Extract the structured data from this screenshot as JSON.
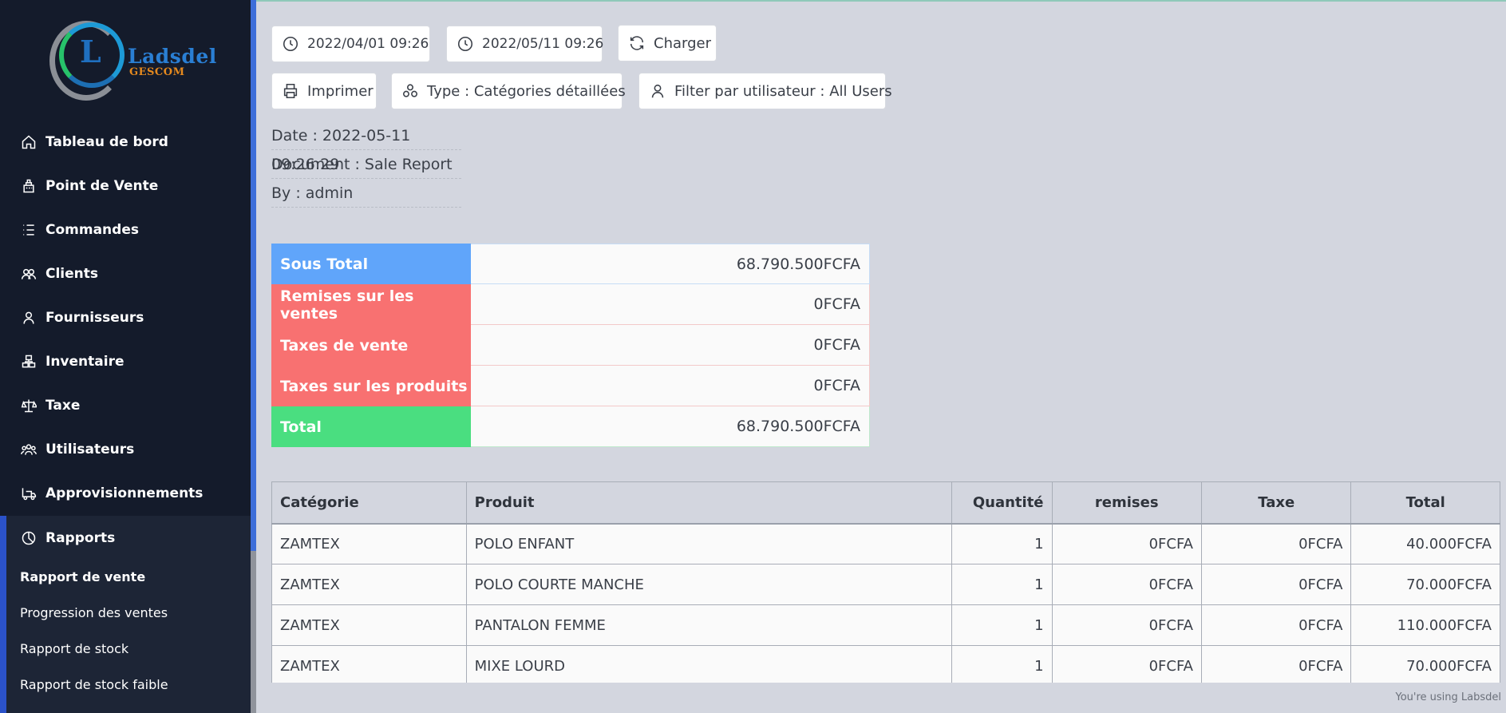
{
  "brand": {
    "letter": "L",
    "name": "Ladsdel",
    "sub": "GESCOM"
  },
  "sidebar": {
    "items": [
      {
        "label": "Tableau de bord",
        "icon": "home-icon"
      },
      {
        "label": "Point de Vente",
        "icon": "cash-register-icon"
      },
      {
        "label": "Commandes",
        "icon": "list-icon"
      },
      {
        "label": "Clients",
        "icon": "users-icon"
      },
      {
        "label": "Fournisseurs",
        "icon": "user-icon"
      },
      {
        "label": "Inventaire",
        "icon": "boxes-icon"
      },
      {
        "label": "Taxe",
        "icon": "scale-icon"
      },
      {
        "label": "Utilisateurs",
        "icon": "group-icon"
      },
      {
        "label": "Approvisionnements",
        "icon": "truck-icon"
      },
      {
        "label": "Rapports",
        "icon": "pie-chart-icon"
      }
    ],
    "sub_items": [
      {
        "label": "Rapport de vente",
        "active": true
      },
      {
        "label": "Progression des ventes"
      },
      {
        "label": "Rapport de stock"
      },
      {
        "label": "Rapport de stock faible"
      }
    ]
  },
  "toolbar": {
    "start_date": "2022/04/01 09:26",
    "end_date": "2022/05/11 09:26",
    "load_label": "Charger",
    "print_label": "Imprimer",
    "type_label": "Type : Catégories détaillées",
    "user_filter_label": "Filter par utilisateur : All Users"
  },
  "meta": {
    "date": "Date : 2022-05-11 09:26:29",
    "document": "Document : Sale Report",
    "by": "By : admin"
  },
  "summary": [
    {
      "label": "Sous Total",
      "value": "68.790.500FCFA",
      "color": "#60a5fa"
    },
    {
      "label": "Remises sur les ventes",
      "value": "0FCFA",
      "color": "#f87171"
    },
    {
      "label": "Taxes de vente",
      "value": "0FCFA",
      "color": "#f87171"
    },
    {
      "label": "Taxes sur les produits",
      "value": "0FCFA",
      "color": "#f87171"
    },
    {
      "label": "Total",
      "value": "68.790.500FCFA",
      "color": "#4ade80"
    }
  ],
  "table": {
    "headers": [
      "Catégorie",
      "Produit",
      "Quantité",
      "remises",
      "Taxe",
      "Total"
    ],
    "rows": [
      [
        "ZAMTEX",
        "POLO ENFANT",
        "1",
        "0FCFA",
        "0FCFA",
        "40.000FCFA"
      ],
      [
        "ZAMTEX",
        "POLO COURTE MANCHE",
        "1",
        "0FCFA",
        "0FCFA",
        "70.000FCFA"
      ],
      [
        "ZAMTEX",
        "PANTALON FEMME",
        "1",
        "0FCFA",
        "0FCFA",
        "110.000FCFA"
      ],
      [
        "ZAMTEX",
        "MIXE LOURD",
        "1",
        "0FCFA",
        "0FCFA",
        "70.000FCFA"
      ]
    ]
  },
  "footer": {
    "note": "You're using Labsdel"
  }
}
